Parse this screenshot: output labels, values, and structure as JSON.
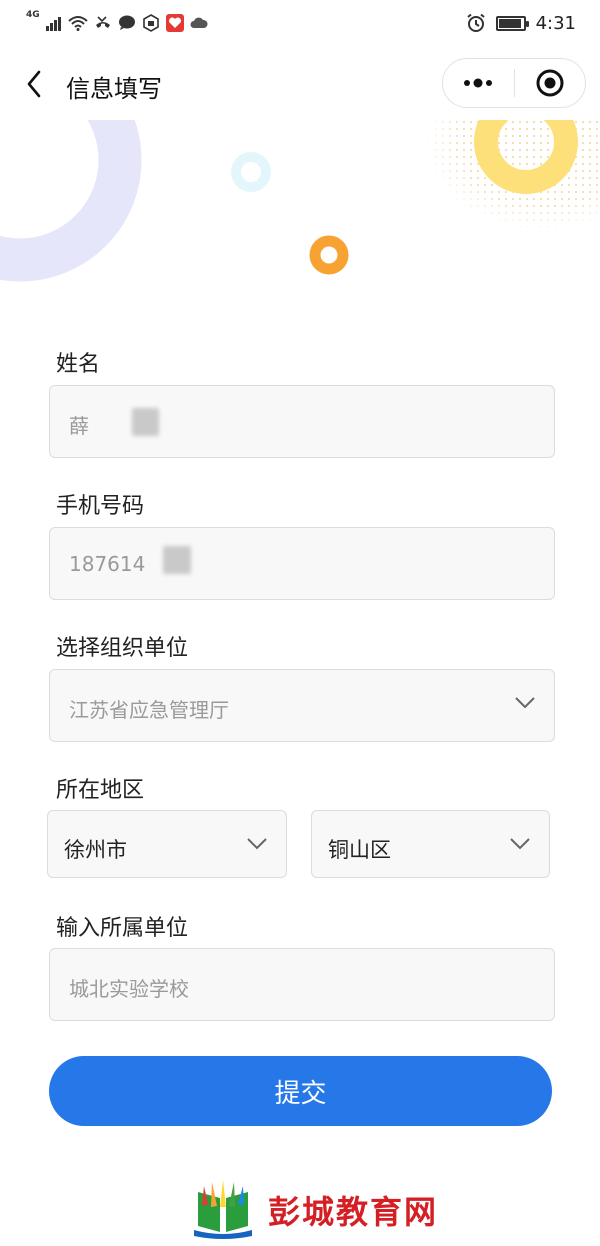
{
  "status_bar": {
    "network": "4G",
    "time": "4:31"
  },
  "nav": {
    "title": "信息填写"
  },
  "form": {
    "name": {
      "label": "姓名",
      "value": "薛"
    },
    "phone": {
      "label": "手机号码",
      "value": "187614"
    },
    "organization": {
      "label": "选择组织单位",
      "value": "江苏省应急管理厅"
    },
    "region": {
      "label": "所在地区",
      "city": "徐州市",
      "district": "铜山区"
    },
    "unit": {
      "label": "输入所属单位",
      "value": "城北实验学校"
    }
  },
  "submit_label": "提交",
  "footer": {
    "logo_text": "彭城教育网"
  },
  "colors": {
    "primary": "#2677e8",
    "deco_lavender": "#e6e6fb",
    "deco_cyan": "#e3f6fb",
    "deco_orange": "#f7a233",
    "deco_yellow": "#fde07a",
    "logo_red": "#d41f25"
  }
}
